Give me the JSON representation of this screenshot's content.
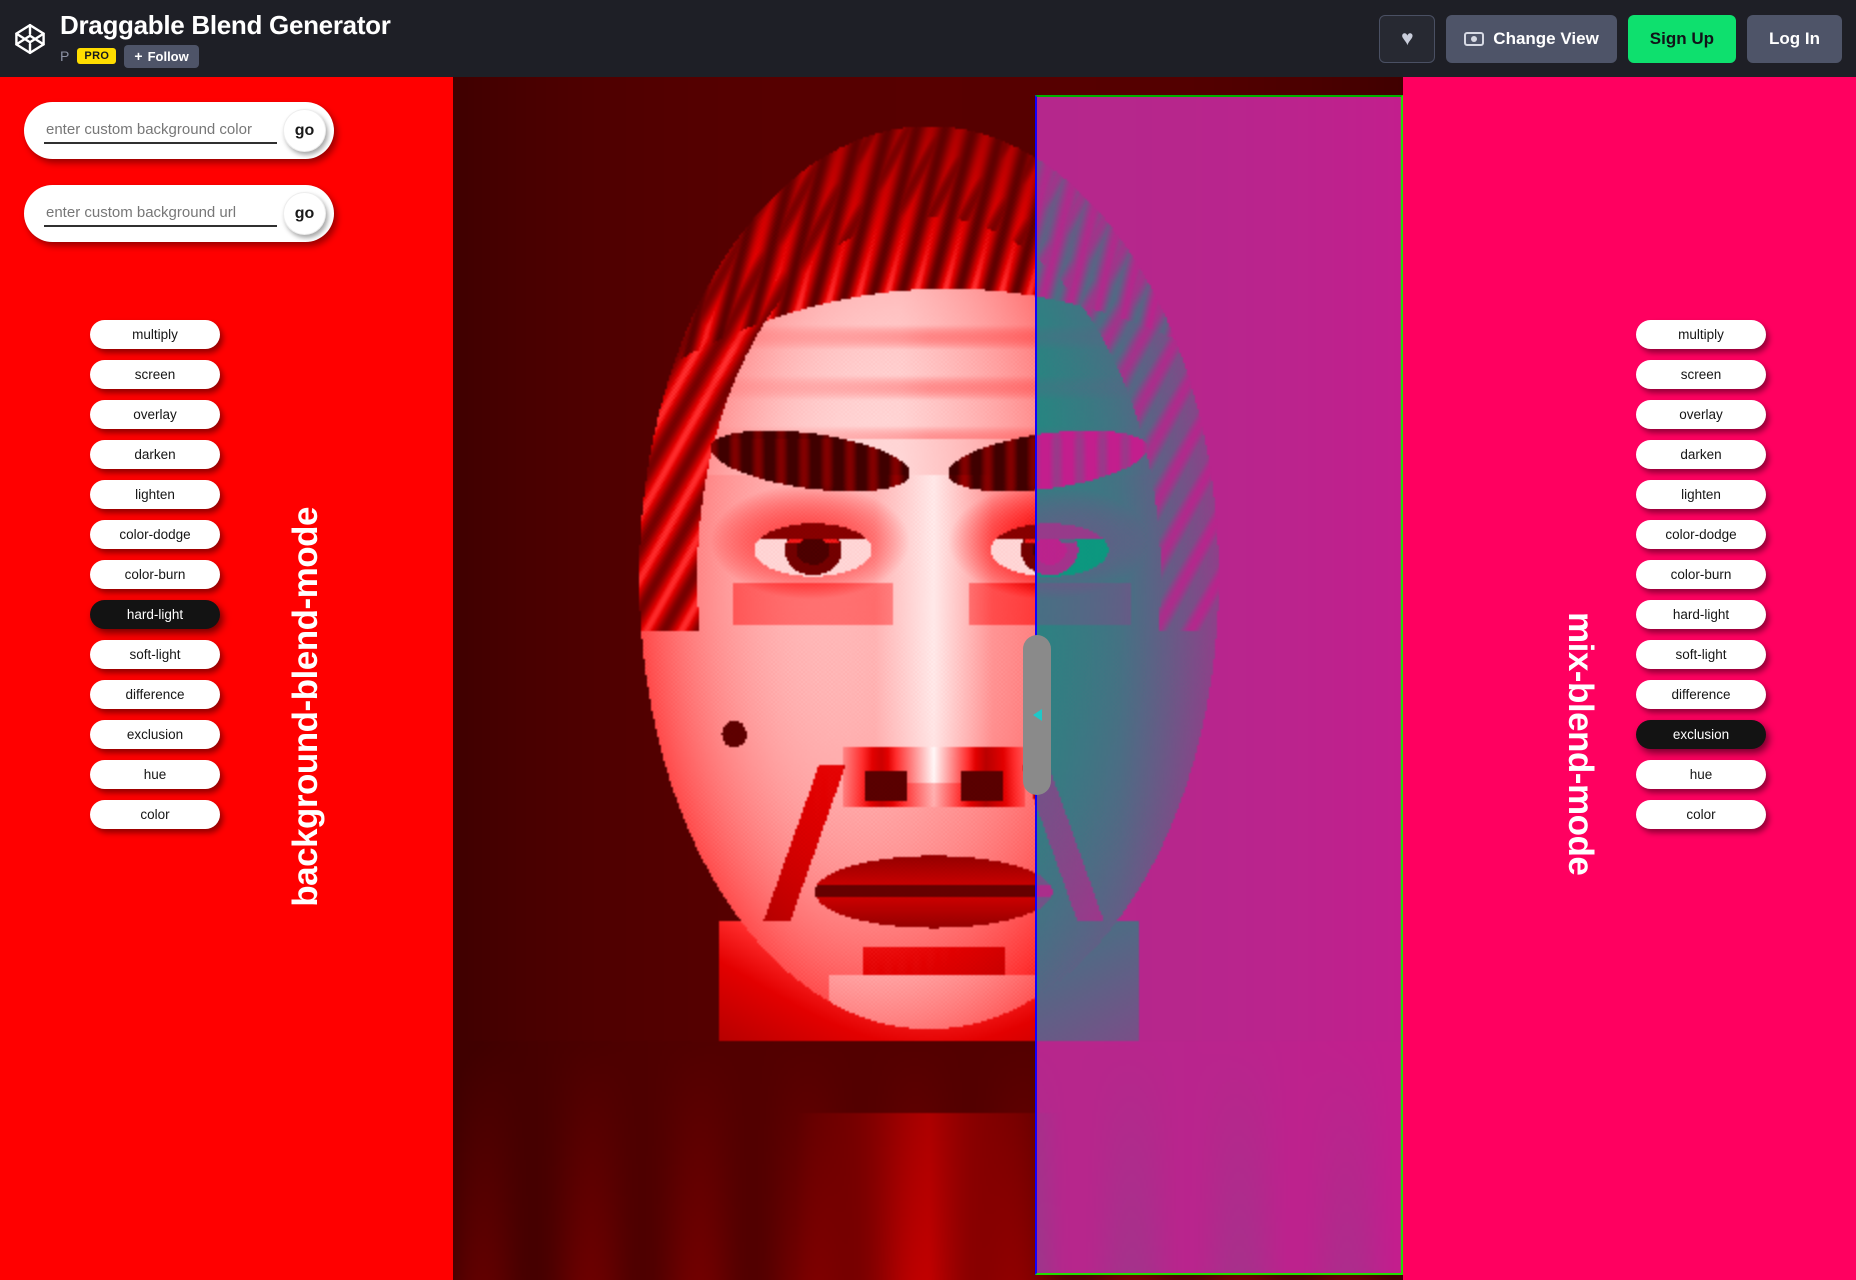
{
  "header": {
    "logo_icon": "codepen-logo-icon",
    "pen_title": "Draggable Blend Generator",
    "author_initial": "P",
    "pro_badge": "PRO",
    "follow_label": "Follow",
    "follow_plus": "+",
    "heart_icon": "heart-icon",
    "heart_glyph": "♥",
    "change_view_label": "Change View",
    "eye_icon": "eye-icon",
    "sign_up_label": "Sign Up",
    "log_in_label": "Log In"
  },
  "colors": {
    "header_bg": "#1e1f26",
    "left_panel": "#ff0000",
    "right_panel": "#ff0060",
    "pro_yellow": "#ffdd00",
    "signup_green": "#0ee06e",
    "button_grey": "#4e5468",
    "active_button": "#131313",
    "overlay_border_left": "#1100ff",
    "overlay_border_green": "#22dd00",
    "drag_handle": "#8a8a8a",
    "drag_arrow": "#1ec8c8"
  },
  "inputs": [
    {
      "name": "background-color-input",
      "placeholder": "enter custom background color",
      "value": "",
      "go_label": "go"
    },
    {
      "name": "background-url-input",
      "placeholder": "enter custom background url",
      "value": "",
      "go_label": "go"
    }
  ],
  "left_panel": {
    "vertical_label": "background-blend-mode",
    "active_mode": "hard-light",
    "modes": [
      "multiply",
      "screen",
      "overlay",
      "darken",
      "lighten",
      "color-dodge",
      "color-burn",
      "hard-light",
      "soft-light",
      "difference",
      "exclusion",
      "hue",
      "color"
    ]
  },
  "right_panel": {
    "vertical_label": "mix-blend-mode",
    "active_mode": "exclusion",
    "modes": [
      "multiply",
      "screen",
      "overlay",
      "darken",
      "lighten",
      "color-dodge",
      "color-burn",
      "hard-light",
      "soft-light",
      "difference",
      "exclusion",
      "hue",
      "color"
    ]
  },
  "canvas": {
    "subject": "portrait-photograph",
    "drag_handle_icon": "drag-handle-left-arrow-icon"
  }
}
